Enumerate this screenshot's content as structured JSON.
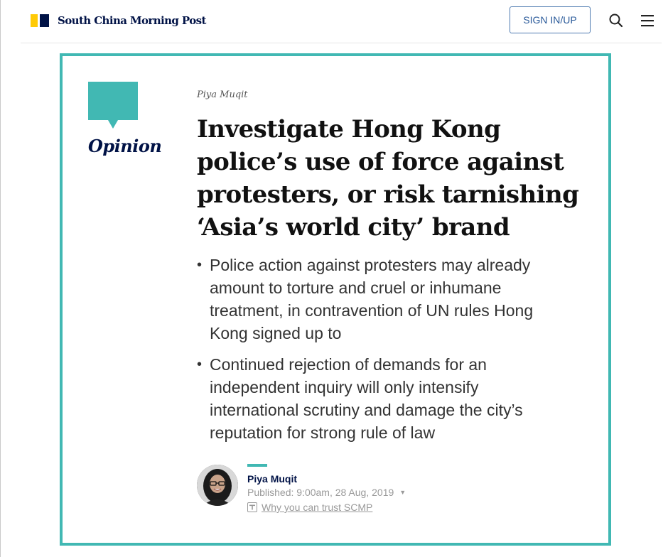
{
  "header": {
    "site_name": "South China Morning Post",
    "signin_label": "SIGN IN/UP",
    "icons": {
      "search": "search-icon",
      "menu": "hamburger-menu-icon"
    },
    "colors": {
      "brand_navy": "#001246",
      "brand_yellow": "#ffca05",
      "signin_border": "#4e7ab0"
    }
  },
  "article": {
    "section_label": "Opinion",
    "byline": "Piya Muqit",
    "headline": "Investigate Hong Kong police’s use of force against protesters, or risk tarnishing ‘Asia’s world city’ brand",
    "summary": [
      "Police action against protesters may already amount to torture and cruel or inhumane treatment, in contravention of UN rules Hong Kong signed up to",
      "Continued rejection of demands for an independent inquiry will only intensify international scrutiny and damage the city’s reputation for strong rule of law"
    ],
    "author": {
      "name": "Piya Muqit",
      "published": "Published: 9:00am, 28 Aug, 2019",
      "trust_link": "Why you can trust SCMP"
    },
    "colors": {
      "accent_teal": "#41b8b3"
    }
  }
}
